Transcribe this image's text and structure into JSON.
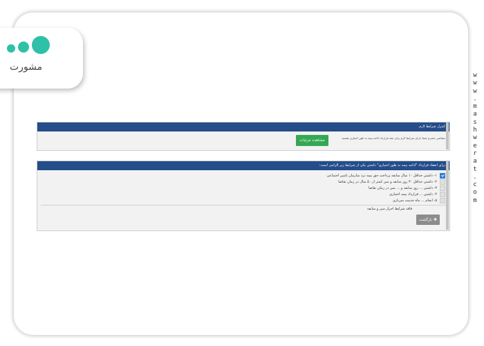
{
  "watermark": {
    "logo_text": "مشورت",
    "side_url": "www.mashwerat.com",
    "brand_color": "#2fc0a8"
  },
  "panel_requirements": {
    "header": "کنترل شرایط لازم",
    "message": "متقاضی محترم شما دارای شرایط لازم برای عقد قرارداد ادامه بیمه به طور اختیاری هستید",
    "details_button": "مشاهده جزئیات",
    "header_color": "#244d8a",
    "button_color": "#34a853"
  },
  "panel_conditions": {
    "header": "برای انعقاد قرارداد \"ادامه بیمه به طور اختیاری\" داشتن یکی از شرایط زیر الزامی است:",
    "items": [
      {
        "text": "۱- داشتن حداقل ۱۰ سال سابقه پرداخت حق بیمه نزد سازمان تامین اجتماعی",
        "checked": true
      },
      {
        "text": "۲- داشتن حداقل ۳۰ روز سابقه و سن کمتر از ۵۰ سال در زمان تقاضا",
        "checked": false
      },
      {
        "text": "۳- داشتن ... روز سابقه و ... سن در زمان تقاضا",
        "checked": false
      },
      {
        "text": "۴- داشتن ... قرارداد بیمه اختیاری",
        "checked": false
      },
      {
        "text": "۵- انجام ... ماه خدمت سربازی",
        "checked": false
      }
    ],
    "footer_note": "فاقد شرایط احراز سن و سابقه",
    "back_button": "بازگشت",
    "back_icon": "plus-icon"
  }
}
